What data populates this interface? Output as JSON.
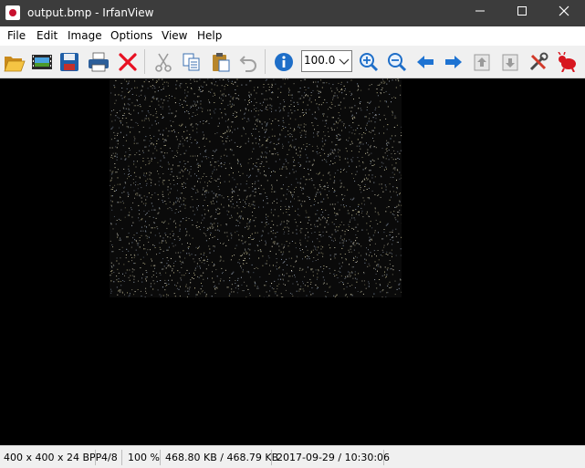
{
  "window": {
    "title": "output.bmp - IrfanView",
    "minimize": "—",
    "maximize": "☐",
    "close": "✕"
  },
  "menu": [
    "File",
    "Edit",
    "Image",
    "Options",
    "View",
    "Help"
  ],
  "toolbar": {
    "zoom_value": "100.0",
    "icons": [
      "open-folder-icon",
      "slideshow-icon",
      "save-icon",
      "print-icon",
      "delete-icon",
      "cut-icon",
      "copy-icon",
      "paste-icon",
      "undo-icon",
      "info-icon",
      "zoom-in-icon",
      "zoom-out-icon",
      "previous-icon",
      "next-icon",
      "previous-page-icon",
      "next-page-icon",
      "settings-icon",
      "irfanview-logo-icon"
    ]
  },
  "status": {
    "dimensions": "400 x 400 x 24 BPP",
    "index": "4/8",
    "zoom": "100 %",
    "size": "468.80 KB / 468.79 KB",
    "datetime": "2017-09-29 / 10:30:06"
  },
  "colors": {
    "titlebar": "#3c3c3c",
    "toolbar": "#f0f0f0",
    "viewer_bg": "#000000",
    "red_x": "#e81123",
    "blue_arrow": "#1e73d2"
  }
}
